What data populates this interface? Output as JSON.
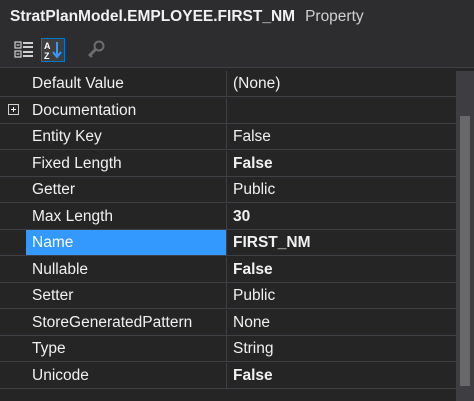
{
  "header": {
    "object_name": "StratPlanModel.EMPLOYEE.FIRST_NM",
    "object_type": "Property"
  },
  "toolbar": {
    "buttons": [
      {
        "icon": "categorized-icon",
        "active": false
      },
      {
        "icon": "alphabetical-sort-icon",
        "active": true
      },
      {
        "icon": "property-pages-icon",
        "active": false
      }
    ]
  },
  "properties": [
    {
      "name": "Default Value",
      "value": "(None)",
      "bold": false
    },
    {
      "name": "Documentation",
      "value": "",
      "expandable": true
    },
    {
      "name": "Entity Key",
      "value": "False",
      "bold": false
    },
    {
      "name": "Fixed Length",
      "value": "False",
      "bold": true
    },
    {
      "name": "Getter",
      "value": "Public",
      "bold": false
    },
    {
      "name": "Max Length",
      "value": "30",
      "bold": true
    },
    {
      "name": "Name",
      "value": "FIRST_NM",
      "bold": true,
      "selected": true
    },
    {
      "name": "Nullable",
      "value": "False",
      "bold": true
    },
    {
      "name": "Setter",
      "value": "Public",
      "bold": false
    },
    {
      "name": "StoreGeneratedPattern",
      "value": "None",
      "bold": false
    },
    {
      "name": "Type",
      "value": "String",
      "bold": false
    },
    {
      "name": "Unicode",
      "value": "False",
      "bold": true
    }
  ],
  "colors": {
    "background": "#252526",
    "selection": "#3399ff",
    "gridline": "#3f3f46",
    "text": "#f1f1f1"
  }
}
